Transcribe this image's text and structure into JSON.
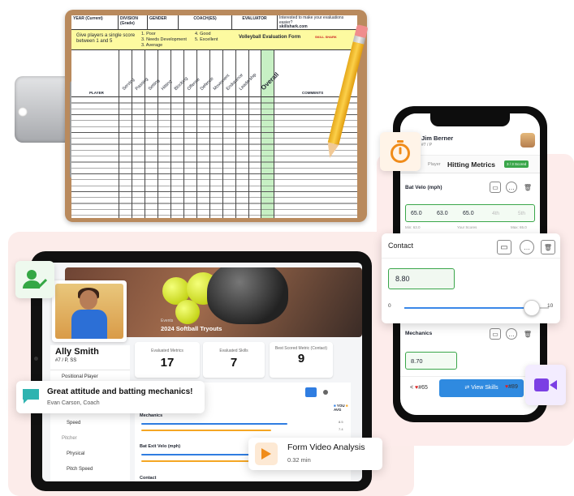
{
  "clipboard": {
    "header_cells": [
      "YEAR (Current)",
      "DIVISION (Grade)",
      "GENDER",
      "COACH(ES)",
      "EVALUATOR"
    ],
    "promo_line1": "Interested to make your evaluations easier?",
    "promo_line2": "skillshark.com",
    "instructions": "Give players a single score between 1 and 5",
    "scale_col1": [
      "1. Poor",
      "3. Needs Development",
      "3. Average"
    ],
    "scale_col2": [
      "4. Good",
      "5. Excellent"
    ],
    "form_title": "Volleyball Evaluation Form",
    "brand": "SKILL SHARK",
    "player_col": "PLAYER",
    "skill_columns": [
      "Serving",
      "Passing",
      "Setting",
      "Hitting",
      "Blocking",
      "Offense",
      "Defense",
      "Movement",
      "Endurance",
      "Leadership"
    ],
    "overall_col": "Overall",
    "comments_col": "COMMENTS"
  },
  "tablet": {
    "event_sub": "Events",
    "event_title": "2024 Softball Tryouts",
    "player_name": "Ally Smith",
    "player_pos": "#7 / P, SS",
    "position_type": "Positional Player",
    "speed_label": "Speed",
    "pitcher_label": "Pitcher",
    "physical_label": "Physical",
    "pitch_speed_label": "Pitch Speed",
    "stats": [
      {
        "label": "Evaluated Metrics",
        "value": "17"
      },
      {
        "label": "Evaluated Skills",
        "value": "7"
      },
      {
        "label": "Best Scored Metric (Contact)",
        "value": "9"
      }
    ],
    "legend_you": "YOU",
    "legend_avg": "AVG",
    "mechanics_label": "Mechanics",
    "mech_you": "8.5",
    "mech_avg": "7.4",
    "bat_exit_label": "Bat Exit Velo (mph)",
    "contact_label": "Contact",
    "colors": {
      "you": "#2f7de1",
      "avg": "#f5a623"
    }
  },
  "phone": {
    "coach_name": "Jim Berner",
    "coach_sub": "#7 / P",
    "section": "Hitting Metrics",
    "player_tag": "Player",
    "scored": "3 / 3 Scored",
    "bat_velo_label": "Bat Velo (mph)",
    "bat_velo_scores": [
      "65.0",
      "63.0",
      "65.0",
      "4th",
      "5th"
    ],
    "bat_velo_min": "Min: 63.0",
    "your_scores": "Your Scores",
    "bat_velo_max": "Max: 65.0",
    "mechanics_label": "Mechanics",
    "mechanics_value": "8.70",
    "prev_player": "#65",
    "view_skills": "View Skills",
    "next_player": "#89"
  },
  "contact_card": {
    "label": "Contact",
    "value": "8.80",
    "min": "0",
    "max": "10",
    "slider_value": 8.8
  },
  "comment_card": {
    "text": "Great attitude and batting mechanics!",
    "author": "Evan Carson, Coach"
  },
  "video_card": {
    "title": "Form Video Analysis",
    "duration": "0.32 min"
  },
  "icons": [
    "stopwatch-icon",
    "user-check-icon",
    "chat-icon",
    "video-camera-icon",
    "play-icon",
    "comment-icon",
    "trash-icon",
    "swap-icon"
  ]
}
